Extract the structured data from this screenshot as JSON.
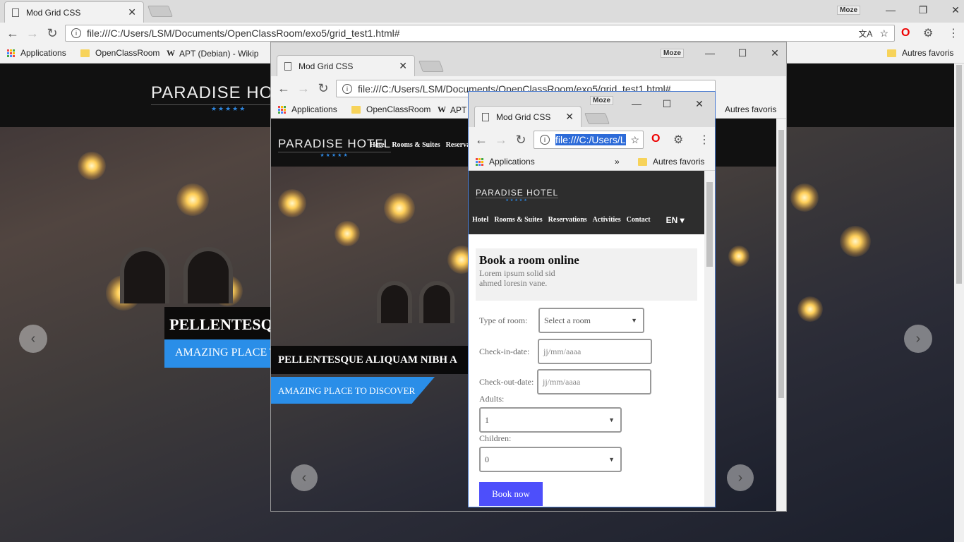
{
  "browser": {
    "tab_title": "Mod Grid CSS",
    "address": "file:///C:/Users/LSM/Documents/OpenClassRoom/exo5/grid_test1.html#",
    "address_short": "file:///C:/Users/L",
    "user_badge": "Moze",
    "bookmarks": {
      "apps": "Applications",
      "openclass": "OpenClassRoom",
      "apt": "APT (Debian) - Wikip",
      "apt_short": "APT",
      "others": "Autres favoris",
      "more": "»"
    },
    "icons": [
      "back-icon",
      "forward-icon",
      "reload-icon",
      "info-icon",
      "translate-icon",
      "star-icon",
      "opera-icon",
      "gear-icon",
      "menu-icon",
      "minimize-icon",
      "maximize-icon",
      "close-icon"
    ]
  },
  "site": {
    "logo": "PARADISE HOTEL",
    "stars": "★★★★★",
    "nav": [
      "Hotel",
      "Rooms & Suites",
      "Reservations",
      "Activities",
      "Contact"
    ],
    "nav_mid": [
      "Hotel",
      "Rooms & Suites",
      "Reserva"
    ],
    "lang": "EN ▾",
    "caption": "PELLENTESQUE ALIQUAM NIBH A",
    "caption_big": "PELLENTESQ",
    "subcaption": "AMAZING PLACE TO DISCOVER",
    "subcaption_big": "AMAZING PLACE T",
    "prev": "‹",
    "next": "›"
  },
  "form": {
    "title": "Book a room online",
    "desc_1": "Lorem ipsum solid sid",
    "desc_2": "ahmed loresin vane.",
    "room_label": "Type of room:",
    "room_value": "Select a room",
    "checkin_label": "Check-in-date:",
    "checkin_placeholder": "jj/mm/aaaa",
    "checkout_label": "Check-out-date:",
    "checkout_placeholder": "jj/mm/aaaa",
    "adults_label": "Adults:",
    "adults_value": "1",
    "children_label": "Children:",
    "children_value": "0",
    "submit": "Book now"
  },
  "colors": {
    "accent_blue": "#2a8ee8",
    "button_purple": "#4d4ffb",
    "star_blue": "#2e87e0"
  }
}
